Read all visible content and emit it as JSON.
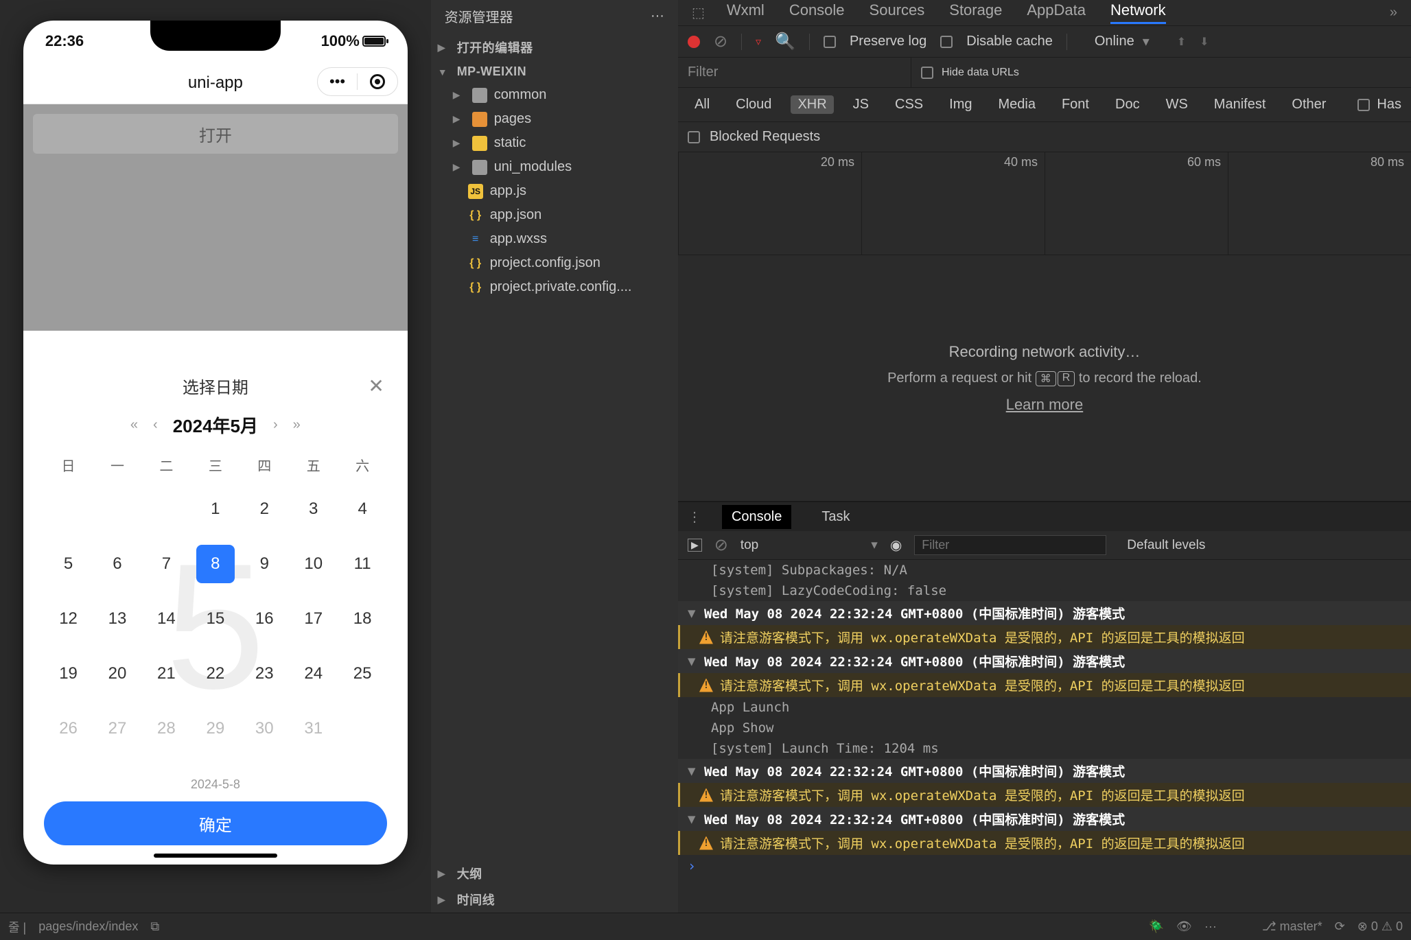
{
  "simulator": {
    "time": "22:36",
    "battery": "100%",
    "app_title": "uni-app",
    "open_label": "打开"
  },
  "datepicker": {
    "title": "选择日期",
    "year_month": "2024年5月",
    "bg_month": "5",
    "weekdays": [
      "日",
      "一",
      "二",
      "三",
      "四",
      "五",
      "六"
    ],
    "rows": [
      [
        {
          "n": "",
          "g": false
        },
        {
          "n": "",
          "g": false
        },
        {
          "n": "",
          "g": false
        },
        {
          "n": "1",
          "g": false
        },
        {
          "n": "2",
          "g": false
        },
        {
          "n": "3",
          "g": false
        },
        {
          "n": "4",
          "g": false
        }
      ],
      [
        {
          "n": "5",
          "g": false
        },
        {
          "n": "6",
          "g": false
        },
        {
          "n": "7",
          "g": false
        },
        {
          "n": "8",
          "g": false,
          "sel": true
        },
        {
          "n": "9",
          "g": false
        },
        {
          "n": "10",
          "g": false
        },
        {
          "n": "11",
          "g": false
        }
      ],
      [
        {
          "n": "12",
          "g": false
        },
        {
          "n": "13",
          "g": false
        },
        {
          "n": "14",
          "g": false
        },
        {
          "n": "15",
          "g": false
        },
        {
          "n": "16",
          "g": false
        },
        {
          "n": "17",
          "g": false
        },
        {
          "n": "18",
          "g": false
        }
      ],
      [
        {
          "n": "19",
          "g": false
        },
        {
          "n": "20",
          "g": false
        },
        {
          "n": "21",
          "g": false
        },
        {
          "n": "22",
          "g": false
        },
        {
          "n": "23",
          "g": false
        },
        {
          "n": "24",
          "g": false
        },
        {
          "n": "25",
          "g": false
        }
      ],
      [
        {
          "n": "26",
          "g": true
        },
        {
          "n": "27",
          "g": true
        },
        {
          "n": "28",
          "g": true
        },
        {
          "n": "29",
          "g": true
        },
        {
          "n": "30",
          "g": true
        },
        {
          "n": "31",
          "g": true
        },
        {
          "n": "",
          "g": false
        }
      ]
    ],
    "footer": "2024-5-8",
    "confirm": "确定"
  },
  "explorer": {
    "title": "资源管理器",
    "open_editors": "打开的编辑器",
    "project": "MP-WEIXIN",
    "folders": [
      {
        "name": "common",
        "icon": "grey"
      },
      {
        "name": "pages",
        "icon": "orange"
      },
      {
        "name": "static",
        "icon": "yellow"
      },
      {
        "name": "uni_modules",
        "icon": "grey"
      }
    ],
    "files": [
      {
        "name": "app.js",
        "type": "js"
      },
      {
        "name": "app.json",
        "type": "json"
      },
      {
        "name": "app.wxss",
        "type": "wxss"
      },
      {
        "name": "project.config.json",
        "type": "json"
      },
      {
        "name": "project.private.config....",
        "type": "json"
      }
    ],
    "outline": "大纲",
    "timeline": "时间线"
  },
  "devtools": {
    "tabs": [
      "Wxml",
      "Console",
      "Sources",
      "Storage",
      "AppData",
      "Network"
    ],
    "active_tab": "Network",
    "preserve_log": "Preserve log",
    "disable_cache": "Disable cache",
    "online": "Online",
    "filter_placeholder": "Filter",
    "hide_data_urls": "Hide data URLs",
    "types": [
      "All",
      "Cloud",
      "XHR",
      "JS",
      "CSS",
      "Img",
      "Media",
      "Font",
      "Doc",
      "WS",
      "Manifest",
      "Other"
    ],
    "active_type": "XHR",
    "has_blocked": "Has",
    "blocked_requests": "Blocked Requests",
    "ticks": [
      "20 ms",
      "40 ms",
      "60 ms",
      "80 ms"
    ],
    "empty_title": "Recording network activity…",
    "empty_sub_a": "Perform a request or hit ",
    "empty_sub_b": " to record the reload.",
    "empty_cmd": "⌘",
    "empty_r": "R",
    "learn": "Learn more"
  },
  "console": {
    "tabs": [
      "Console",
      "Task"
    ],
    "active": "Console",
    "top": "top",
    "filter_placeholder": "Filter",
    "levels": "Default levels",
    "lines": [
      {
        "type": "system",
        "text": "[system] Subpackages: N/A"
      },
      {
        "type": "system",
        "text": "[system] LazyCodeCoding: false"
      },
      {
        "type": "group",
        "text": "Wed May 08 2024 22:32:24 GMT+0800 (中国标准时间) 游客模式"
      },
      {
        "type": "warn",
        "text": "请注意游客模式下，调用 wx.operateWXData 是受限的，API 的返回是工具的模拟返回"
      },
      {
        "type": "group",
        "text": "Wed May 08 2024 22:32:24 GMT+0800 (中国标准时间) 游客模式"
      },
      {
        "type": "warn",
        "text": "请注意游客模式下，调用 wx.operateWXData 是受限的，API 的返回是工具的模拟返回"
      },
      {
        "type": "system",
        "text": "App Launch"
      },
      {
        "type": "system",
        "text": "App Show"
      },
      {
        "type": "system",
        "text": "[system] Launch Time: 1204 ms"
      },
      {
        "type": "group",
        "text": "Wed May 08 2024 22:32:24 GMT+0800 (中国标准时间) 游客模式"
      },
      {
        "type": "warn",
        "text": "请注意游客模式下，调用 wx.operateWXData 是受限的，API 的返回是工具的模拟返回"
      },
      {
        "type": "group",
        "text": "Wed May 08 2024 22:32:24 GMT+0800 (中国标准时间) 游客模式"
      },
      {
        "type": "warn",
        "text": "请注意游客模式下，调用 wx.operateWXData 是受限的，API 的返回是工具的模拟返回"
      }
    ]
  },
  "statusbar": {
    "path": "pages/index/index",
    "branch": "master*",
    "errors": "0",
    "warnings": "0"
  }
}
